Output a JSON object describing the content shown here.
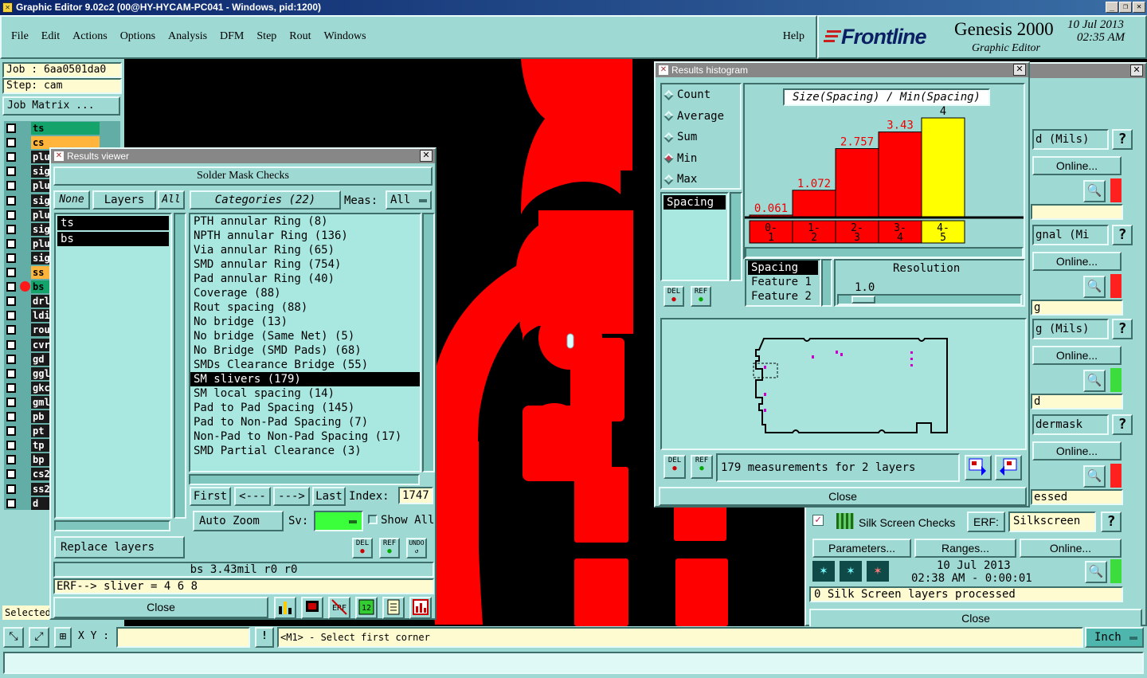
{
  "window": {
    "title": "Graphic Editor 9.02c2 (00@HY-HYCAM-PC041 - Windows, pid:1200)"
  },
  "menu": {
    "items": [
      "File",
      "Edit",
      "Actions",
      "Options",
      "Analysis",
      "DFM",
      "Step",
      "Rout",
      "Windows"
    ],
    "help": "Help"
  },
  "brand": {
    "logo": "Frontline",
    "product": "Genesis 2000",
    "sub": "Graphic Editor",
    "date": "10 Jul 2013",
    "time": "02:35 AM"
  },
  "job": {
    "job": "Job : 6aa0501da0",
    "step": "Step: cam",
    "matrix": "Job Matrix ..."
  },
  "layers": [
    {
      "name": "ts",
      "color": "#14a36a"
    },
    {
      "name": "cs",
      "color": "#ffb43c"
    },
    {
      "name": "plu",
      "color": ""
    },
    {
      "name": "sig",
      "color": ""
    },
    {
      "name": "plu",
      "color": ""
    },
    {
      "name": "sig",
      "color": ""
    },
    {
      "name": "plu",
      "color": ""
    },
    {
      "name": "sig",
      "color": ""
    },
    {
      "name": "plu",
      "color": ""
    },
    {
      "name": "sig",
      "color": ""
    },
    {
      "name": "ss",
      "color": "#ffb43c"
    },
    {
      "name": "bs",
      "color": "#14a36a"
    },
    {
      "name": "drl",
      "color": ""
    },
    {
      "name": "ldi",
      "color": ""
    },
    {
      "name": "rou",
      "color": ""
    },
    {
      "name": "cvr",
      "color": ""
    },
    {
      "name": "gd",
      "color": ""
    },
    {
      "name": "ggl",
      "color": ""
    },
    {
      "name": "gkc",
      "color": ""
    },
    {
      "name": "gml",
      "color": ""
    },
    {
      "name": "pb",
      "color": ""
    },
    {
      "name": "pt",
      "color": ""
    },
    {
      "name": "tp",
      "color": ""
    },
    {
      "name": "bp",
      "color": ""
    },
    {
      "name": "cs2",
      "color": ""
    },
    {
      "name": "ss2",
      "color": ""
    },
    {
      "name": "d",
      "color": ""
    }
  ],
  "selected_label": "Selected",
  "results_viewer": {
    "title": "Results viewer",
    "heading": "Solder Mask Checks",
    "none": "None",
    "layers": "Layers",
    "all": "All",
    "categories": "Categories (22)",
    "meas_label": "Meas:",
    "meas_value": "All",
    "layer_list": [
      "ts",
      "bs"
    ],
    "category_list": [
      "PTH annular Ring (8)",
      "NPTH annular Ring (136)",
      "Via annular Ring (65)",
      "SMD annular Ring (754)",
      "Pad annular Ring (40)",
      "Coverage (88)",
      "Rout spacing (88)",
      "No bridge (13)",
      "No bridge (Same Net) (5)",
      "No Bridge (SMD Pads) (68)",
      "SMDs Clearance Bridge (55)",
      "SM slivers (179)",
      "SM local spacing (14)",
      "Pad to Pad Spacing (145)",
      "Pad to Non-Pad Spacing (7)",
      "Non-Pad to Non-Pad Spacing (17)",
      "SMD Partial Clearance (3)"
    ],
    "selected_category": "SM slivers (179)",
    "first": "First",
    "prev": "<---",
    "next": "--->",
    "last": "Last",
    "index_label": "Index:",
    "index_value": "1747",
    "auto_zoom": "Auto Zoom",
    "sv": "Sv:",
    "show_all": "Show All",
    "replace": "Replace layers",
    "status": "bs 3.43mil  r0  r0",
    "erf": "ERF--> sliver = 4 6 8",
    "close": "Close",
    "del": "DEL",
    "ref": "REF",
    "undo": "UNDO"
  },
  "histogram": {
    "title": "Results histogram",
    "caption": "Size(Spacing) / Min(Spacing)",
    "modes": [
      "Count",
      "Average",
      "Sum",
      "Min",
      "Max"
    ],
    "selected_mode": "Min",
    "metric_list": [
      "Spacing"
    ],
    "bars": [
      {
        "label": "0.061",
        "value": 0.061,
        "color": "#ff0000"
      },
      {
        "label": "1.072",
        "value": 1.072,
        "color": "#ff0000"
      },
      {
        "label": "2.757",
        "value": 2.757,
        "color": "#ff0000"
      },
      {
        "label": "3.43",
        "value": 3.43,
        "color": "#ff0000"
      },
      {
        "label": "4",
        "value": 4,
        "color": "#ffff00"
      }
    ],
    "bins": [
      "0-\n1",
      "1-\n2",
      "2-\n3",
      "3-\n4",
      "4-\n5"
    ],
    "attr_list": [
      "Spacing",
      "Feature 1",
      "Feature 2"
    ],
    "resolution_label": "Resolution",
    "resolution_value": "1.0",
    "measurements": "179 measurements for 2 layers",
    "close": "Close"
  },
  "right_panel": {
    "rows": [
      {
        "text": "d (Mils)",
        "online": "Online...",
        "field": "",
        "red": true
      },
      {
        "text": "gnal (Mi",
        "online": "Online...",
        "field": "g",
        "red": true
      },
      {
        "text": "g (Mils)",
        "online": "Online...",
        "field": "d",
        "red": false
      },
      {
        "text": "dermask",
        "online": "Online...",
        "field": "essed",
        "red": true
      }
    ],
    "silk": {
      "title": "Silk Screen Checks",
      "erf": "ERF:",
      "erf_value": "Silkscreen",
      "parameters": "Parameters...",
      "ranges": "Ranges...",
      "online": "Online...",
      "date": "10 Jul 2013",
      "time": "02:38 AM - 0:00:01",
      "processed": "0 Silk Screen layers processed",
      "close": "Close"
    }
  },
  "bottom": {
    "xy_label": "X Y :",
    "message": "<M1> - Select first corner",
    "unit": "Inch"
  }
}
